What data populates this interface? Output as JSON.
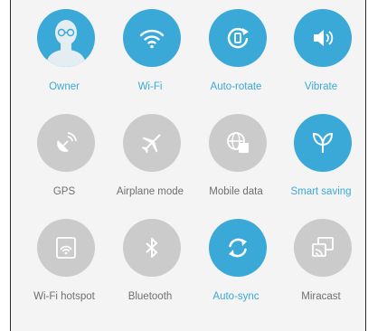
{
  "colors": {
    "accent": "#3aa9d8",
    "inactive": "#cbcbcb",
    "inactive_text": "#6f6f6f",
    "panel_bg": "#f4f4f4"
  },
  "tiles": [
    {
      "label": "Owner",
      "icon": "avatar-icon",
      "active": true
    },
    {
      "label": "Wi-Fi",
      "icon": "wifi-icon",
      "active": true
    },
    {
      "label": "Auto-rotate",
      "icon": "auto-rotate-icon",
      "active": true
    },
    {
      "label": "Vibrate",
      "icon": "vibrate-icon",
      "active": true
    },
    {
      "label": "GPS",
      "icon": "gps-icon",
      "active": false
    },
    {
      "label": "Airplane mode",
      "icon": "airplane-icon",
      "active": false
    },
    {
      "label": "Mobile data",
      "icon": "mobile-data-icon",
      "active": false
    },
    {
      "label": "Smart saving",
      "icon": "leaf-icon",
      "active": true
    },
    {
      "label": "Wi-Fi hotspot",
      "icon": "hotspot-icon",
      "active": false
    },
    {
      "label": "Bluetooth",
      "icon": "bluetooth-icon",
      "active": false
    },
    {
      "label": "Auto-sync",
      "icon": "sync-icon",
      "active": true
    },
    {
      "label": "Miracast",
      "icon": "miracast-icon",
      "active": false
    }
  ]
}
